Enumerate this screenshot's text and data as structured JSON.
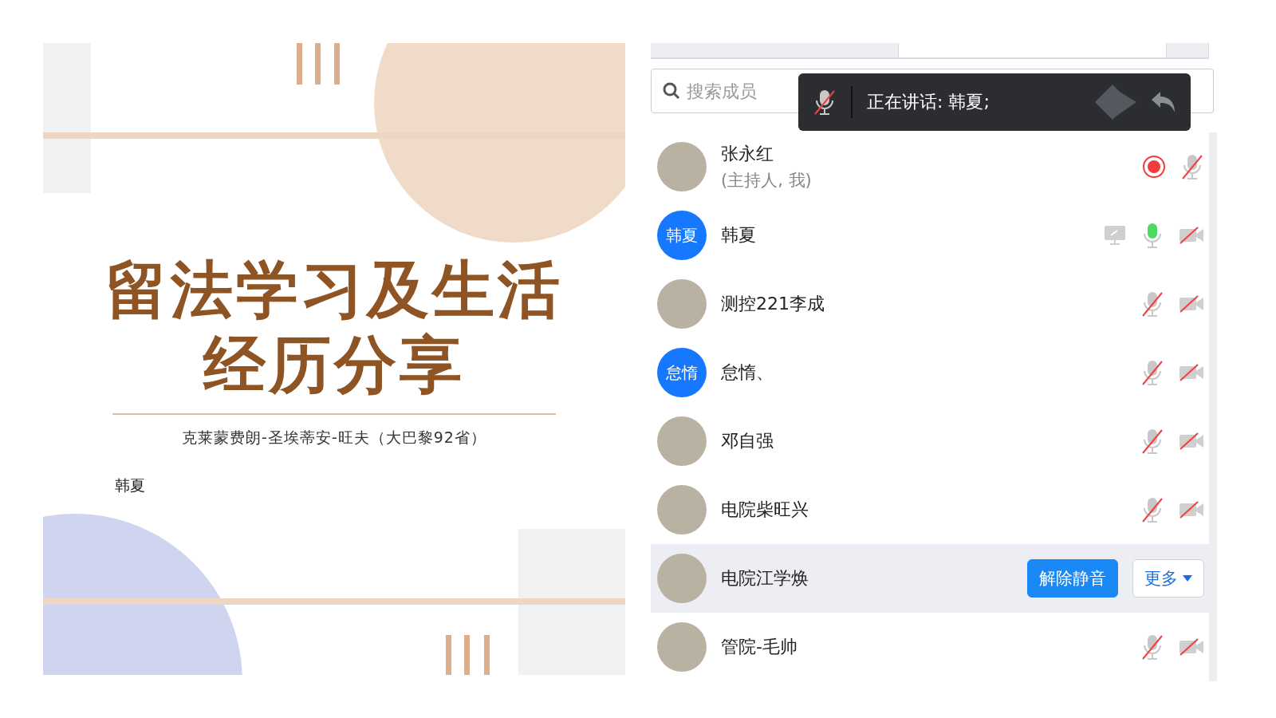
{
  "slide": {
    "title_lines": [
      "留法学习及生活",
      "经历分享"
    ],
    "subtitle": "克莱蒙费朗-圣埃蒂安-旺夫（大巴黎92省）",
    "presenter": "韩夏"
  },
  "members_panel": {
    "search": {
      "placeholder": "搜索成员"
    },
    "speaking_banner": {
      "mic_muted": true,
      "text": "正在讲话: 韩夏;"
    },
    "members": [
      {
        "name": "张永红",
        "role": "(主持人, 我)",
        "avatar": {
          "kind": "photo"
        },
        "selected": false,
        "indicators": [
          {
            "kind": "recording"
          },
          {
            "kind": "mic",
            "muted": true
          }
        ]
      },
      {
        "name": "韩夏",
        "avatar": {
          "kind": "initials",
          "text": "韩夏"
        },
        "selected": false,
        "indicators": [
          {
            "kind": "screen"
          },
          {
            "kind": "mic",
            "muted": false
          },
          {
            "kind": "camera",
            "muted": true
          }
        ]
      },
      {
        "name": "测控221李成",
        "avatar": {
          "kind": "photo"
        },
        "selected": false,
        "indicators": [
          {
            "kind": "mic",
            "muted": true
          },
          {
            "kind": "camera",
            "muted": true
          }
        ]
      },
      {
        "name": "怠惰、",
        "avatar": {
          "kind": "initials",
          "text": "怠惰"
        },
        "selected": false,
        "indicators": [
          {
            "kind": "mic",
            "muted": true
          },
          {
            "kind": "camera",
            "muted": true
          }
        ]
      },
      {
        "name": "邓自强",
        "avatar": {
          "kind": "photo"
        },
        "selected": false,
        "indicators": [
          {
            "kind": "mic",
            "muted": true
          },
          {
            "kind": "camera",
            "muted": true
          }
        ]
      },
      {
        "name": "电院柴旺兴",
        "avatar": {
          "kind": "photo"
        },
        "selected": false,
        "indicators": [
          {
            "kind": "mic",
            "muted": true
          },
          {
            "kind": "camera",
            "muted": true
          }
        ]
      },
      {
        "name": "电院江学焕",
        "avatar": {
          "kind": "photo"
        },
        "selected": true,
        "actions": [
          {
            "label": "解除静音",
            "kind": "primary"
          },
          {
            "label": "更多",
            "kind": "dropdown"
          }
        ]
      },
      {
        "name": "管院-毛帅",
        "avatar": {
          "kind": "photo"
        },
        "selected": false,
        "indicators": [
          {
            "kind": "mic",
            "muted": true
          },
          {
            "kind": "camera",
            "muted": true
          }
        ]
      }
    ]
  }
}
